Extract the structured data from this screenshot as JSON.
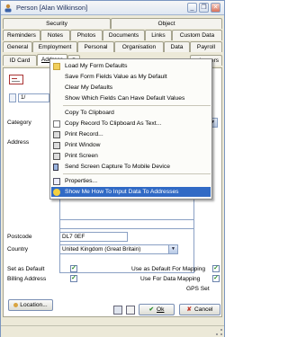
{
  "window": {
    "title": "Person [Alan Wilkinson]",
    "minimize_glyph": "_",
    "restore_glyph": "❐",
    "close_glyph": "✕"
  },
  "tabs_row1": [
    "Security",
    "Object"
  ],
  "tabs_row2": [
    "Reminders",
    "Notes",
    "Photos",
    "Documents",
    "Links",
    "Custom Data"
  ],
  "tabs_row3": [
    "General",
    "Employment",
    "Personal",
    "Organisation",
    "Data",
    "Payroll"
  ],
  "tabs_row4": [
    "ID Card",
    "Address",
    "S",
    "…lanners"
  ],
  "record_counter": "1/",
  "fields": {
    "category_label": "Category",
    "address_label": "Address",
    "postcode_label": "Postcode",
    "postcode_value": "DL7 0EF",
    "country_label": "Country",
    "country_value": "United Kingdom (Great Britain)",
    "set_default_label": "Set as Default",
    "billing_label": "Billing Address",
    "mapping_default_label": "Use as Default For Mapping",
    "data_mapping_label": "Use For Data Mapping",
    "gps_label": "GPS Set"
  },
  "buttons": {
    "location": "Location...",
    "ok": "Ok",
    "cancel": "Cancel",
    "ok_glyph": "✔",
    "cancel_glyph": "✘"
  },
  "context_menu": {
    "items": [
      {
        "label": "Load My Form Defaults",
        "icon": "folder-icon"
      },
      {
        "label": "Save Form Fields Value as My Default",
        "icon": ""
      },
      {
        "label": "Clear My Defaults",
        "icon": ""
      },
      {
        "label": "Show Which Fields Can Have Default Values",
        "icon": ""
      },
      {
        "label": "Copy To Clipboard",
        "icon": ""
      },
      {
        "label": "Copy Record To Clipboard As Text...",
        "icon": "copy-icon"
      },
      {
        "label": "Print Record...",
        "icon": "print-icon"
      },
      {
        "label": "Print Window",
        "icon": "print-icon"
      },
      {
        "label": "Print Screen",
        "icon": "print-icon"
      },
      {
        "label": "Send Screen Capture To Mobile Device",
        "icon": "mobile-icon"
      },
      {
        "label": "Properties...",
        "icon": "properties-icon"
      },
      {
        "label": "Show Me How To Input Data To Addresses",
        "icon": "help-icon",
        "highlighted": true
      }
    ]
  },
  "colors": {
    "highlight": "#316ac5",
    "title_text": "#1e2f5a",
    "check": "#2a8a2a"
  }
}
